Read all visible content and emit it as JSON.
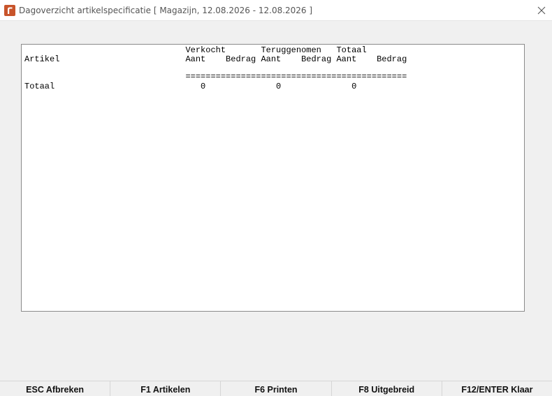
{
  "window": {
    "title": "Dagoverzicht artikelspecificatie [ Magazijn, 12.08.2026 - 12.08.2026 ]",
    "icon": "app-logo-icon",
    "close_icon": "close-icon"
  },
  "report": {
    "lines": [
      "                                Verkocht       Teruggenomen   Totaal",
      "Artikel                         Aant    Bedrag Aant    Bedrag Aant    Bedrag",
      "",
      "                                ============================================",
      "Totaal                             0              0              0"
    ]
  },
  "function_keys": [
    "ESC Afbreken",
    "F1 Artikelen",
    "F6 Printen",
    "F8 Uitgebreid",
    "F12/ENTER Klaar"
  ]
}
